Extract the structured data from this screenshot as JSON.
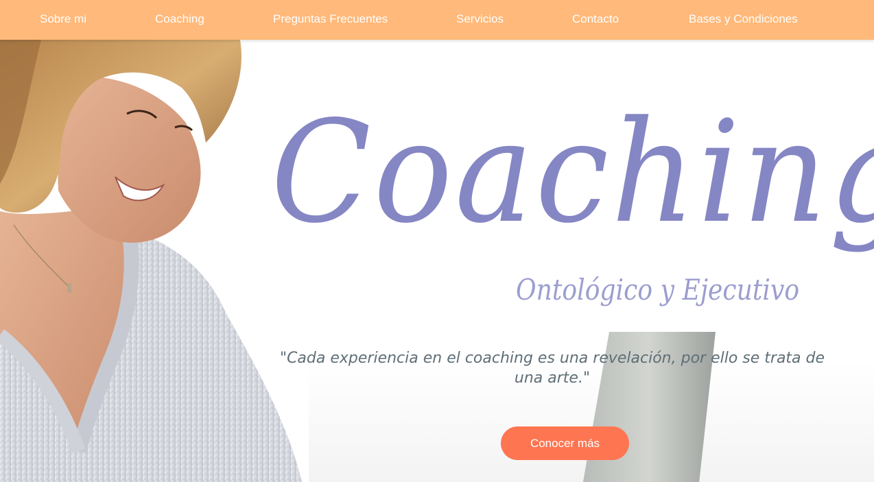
{
  "nav": {
    "items": [
      {
        "label": "Sobre mi"
      },
      {
        "label": "Coaching"
      },
      {
        "label": "Preguntas Frecuentes"
      },
      {
        "label": "Servicios"
      },
      {
        "label": "Contacto"
      },
      {
        "label": "Bases y Condiciones"
      }
    ]
  },
  "hero": {
    "title": "Coaching",
    "subtitle": "Ontológico y Ejecutivo",
    "quote": "\"Cada experiencia en el coaching es una revelación, por ello se trata de una arte.\"",
    "cta_label": "Conocer más"
  },
  "colors": {
    "nav_bg": "#ffb97a",
    "title": "#8586c4",
    "quote": "#5f6e76",
    "cta_bg": "#fd7651"
  }
}
